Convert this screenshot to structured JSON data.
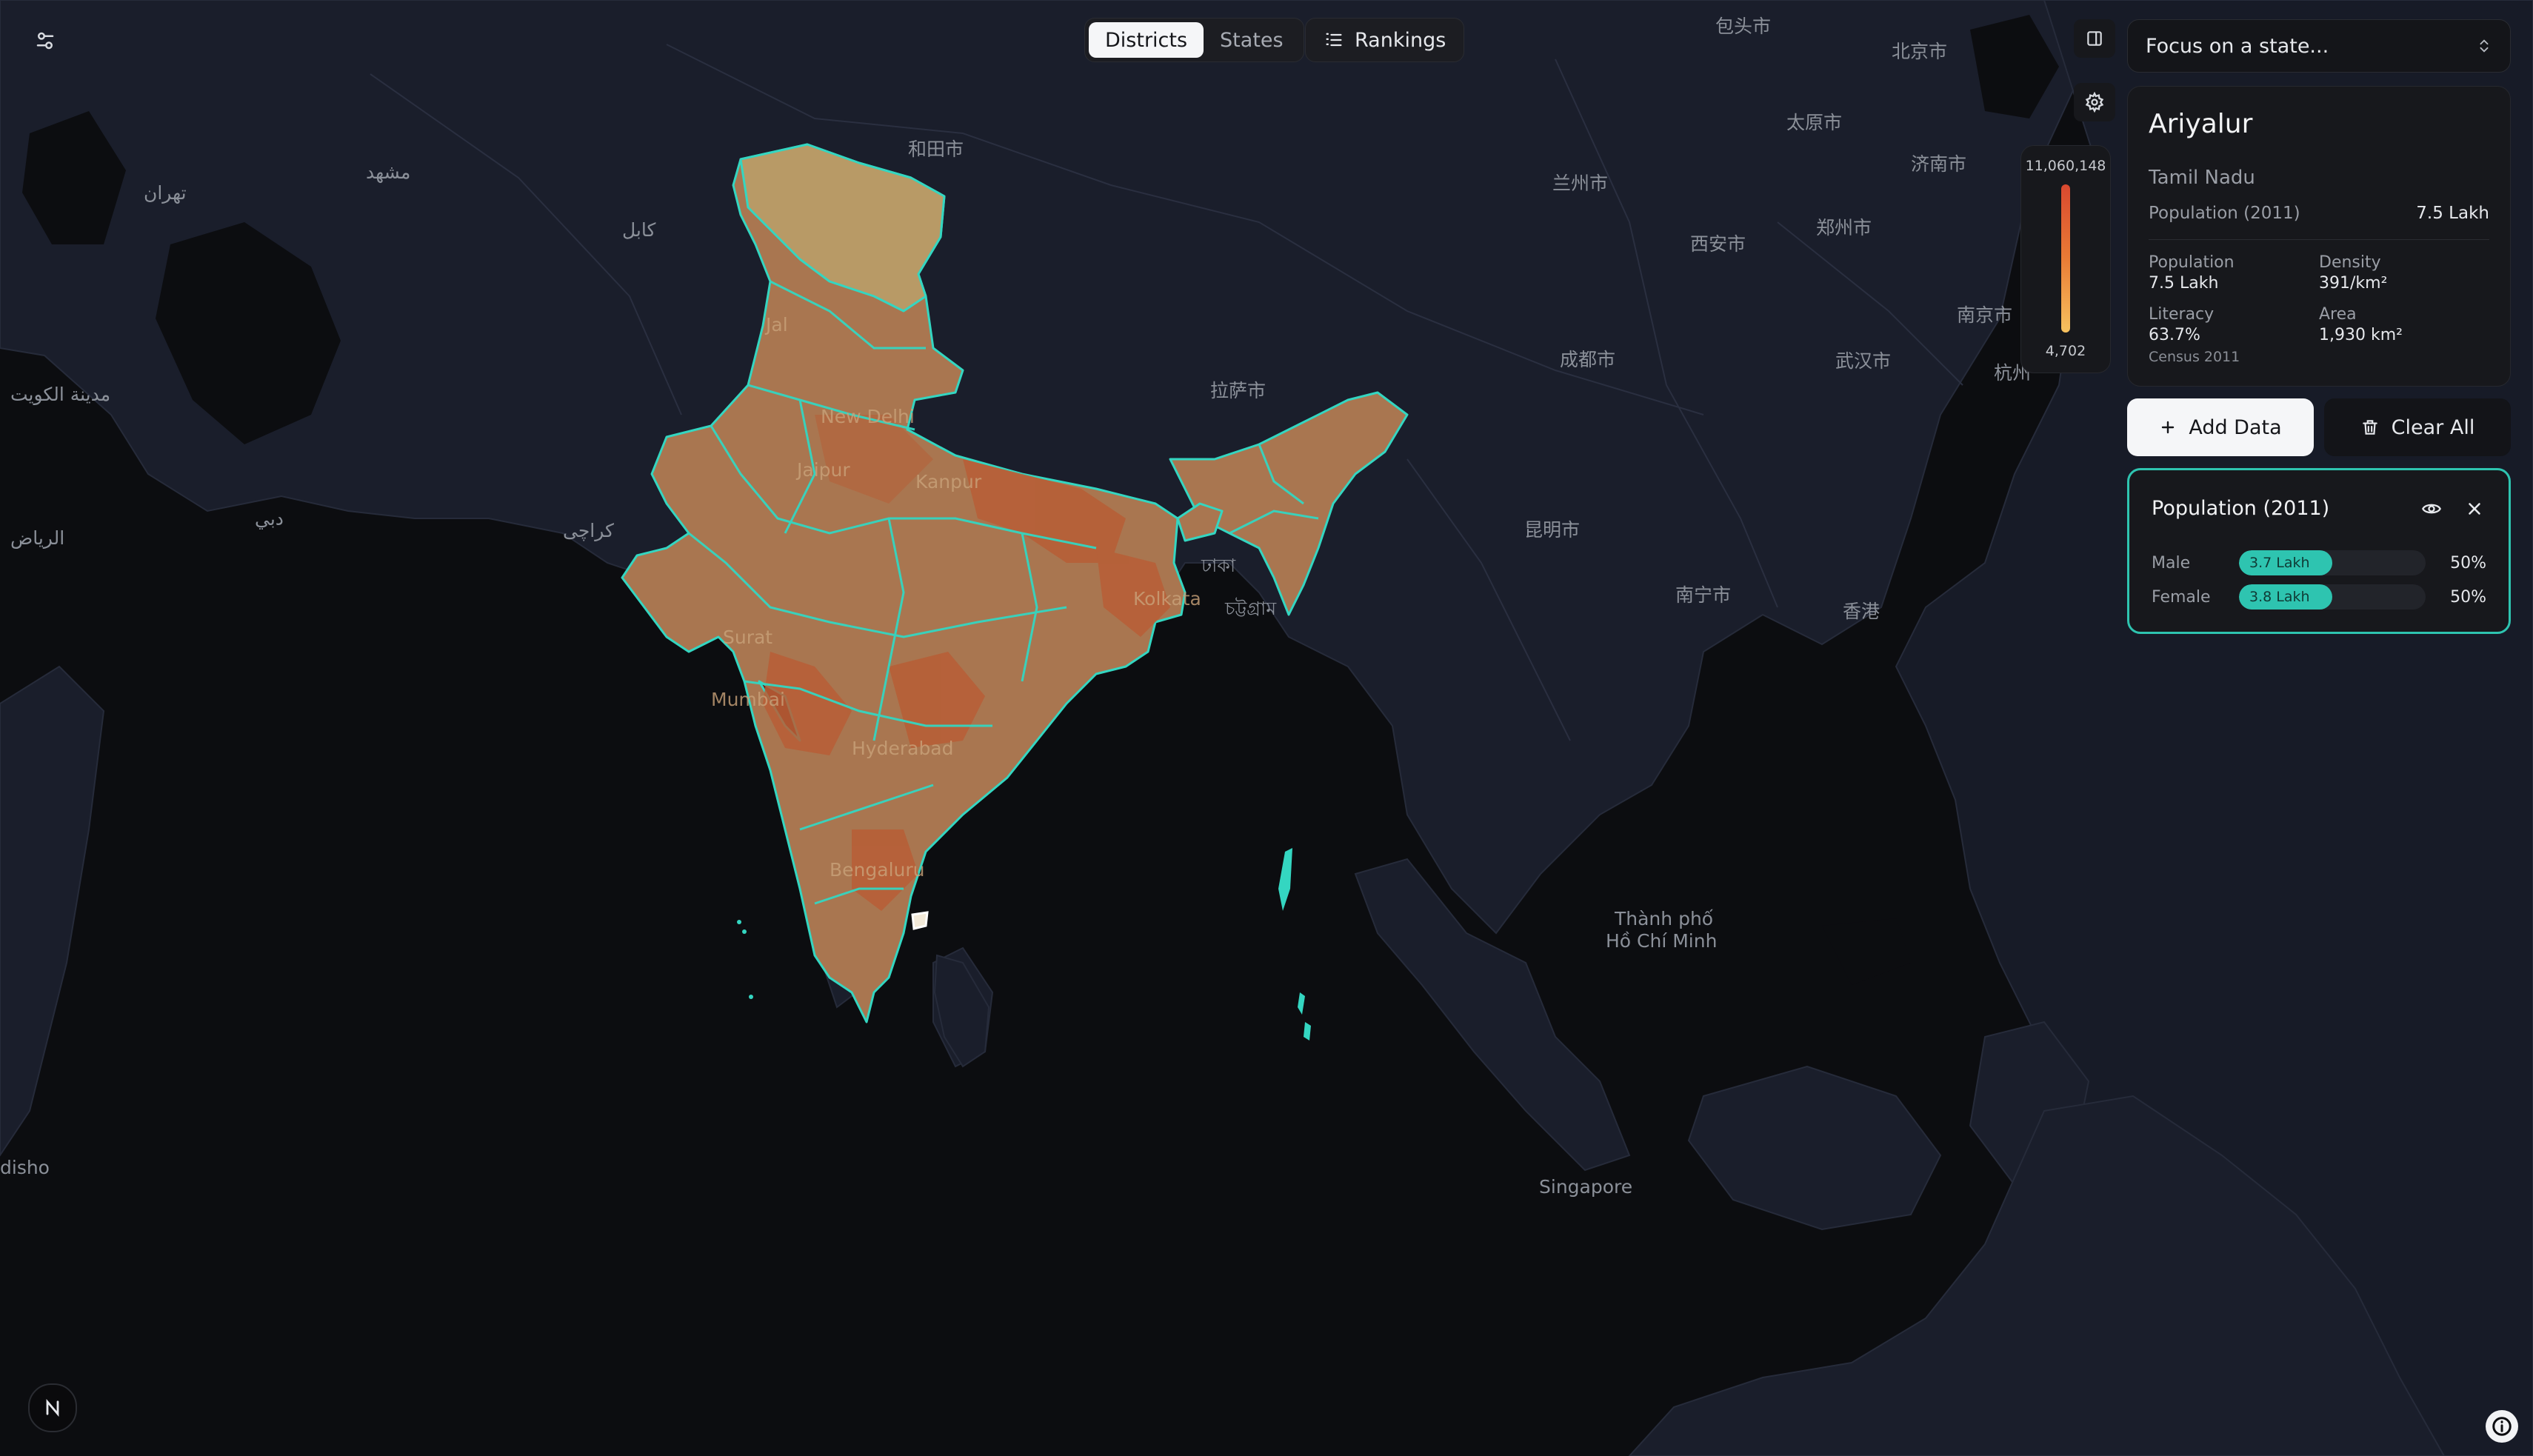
{
  "view_tabs": [
    {
      "label": "Districts",
      "active": true
    },
    {
      "label": "States",
      "active": false
    }
  ],
  "rankings_label": "Rankings",
  "focus_placeholder": "Focus on a state...",
  "district_info": {
    "name": "Ariyalur",
    "state": "Tamil Nadu",
    "population_label": "Population (2011)",
    "population_value": "7.5 Lakh",
    "stats": [
      {
        "label": "Population",
        "value": "7.5 Lakh"
      },
      {
        "label": "Density",
        "value": "391/km²"
      },
      {
        "label": "Literacy",
        "value": "63.7%"
      },
      {
        "label": "Area",
        "value": "1,930 km²"
      }
    ],
    "source": "Census 2011"
  },
  "legend": {
    "max": "11,060,148",
    "min": "4,702",
    "color_high": "#d9482f",
    "color_low": "#f7c25f"
  },
  "actions": {
    "add_data": "Add Data",
    "clear_all": "Clear All"
  },
  "layer": {
    "title": "Population (2011)",
    "rows": [
      {
        "label": "Male",
        "value": "3.7 Lakh",
        "percent": "50%",
        "fill": 0.5
      },
      {
        "label": "Female",
        "value": "3.8 Lakh",
        "percent": "50%",
        "fill": 0.5
      }
    ]
  },
  "accent_color": "#2ec4b0",
  "map_labels": [
    {
      "text": "包头市"
    },
    {
      "text": "北京市"
    },
    {
      "text": "太原市"
    },
    {
      "text": "济南市"
    },
    {
      "text": "兰州市"
    },
    {
      "text": "郑州市"
    },
    {
      "text": "西安市"
    },
    {
      "text": "南京市"
    },
    {
      "text": "成都市"
    },
    {
      "text": "武汉市"
    },
    {
      "text": "杭州"
    },
    {
      "text": "拉萨市"
    },
    {
      "text": "和田市"
    },
    {
      "text": "昆明市"
    },
    {
      "text": "南宁市"
    },
    {
      "text": "香港"
    },
    {
      "text": "تهران"
    },
    {
      "text": "مشهد"
    },
    {
      "text": "کابل"
    },
    {
      "text": "مدينة الكويت"
    },
    {
      "text": "الرياض"
    },
    {
      "text": "دبي"
    },
    {
      "text": "کراچی"
    },
    {
      "text": "ঢাকা"
    },
    {
      "text": "চট্টগ্রাম"
    },
    {
      "text": "Thành phố"
    },
    {
      "text": "Hồ Chí Minh"
    },
    {
      "text": "Singapore"
    },
    {
      "text": "disho"
    },
    {
      "text": "New Delhi"
    },
    {
      "text": "Jaipur"
    },
    {
      "text": "Kanpur"
    },
    {
      "text": "Surat"
    },
    {
      "text": "Mumbai"
    },
    {
      "text": "Hyderabad"
    },
    {
      "text": "Bengaluru"
    },
    {
      "text": "Kolkata"
    },
    {
      "text": "Jal"
    }
  ]
}
